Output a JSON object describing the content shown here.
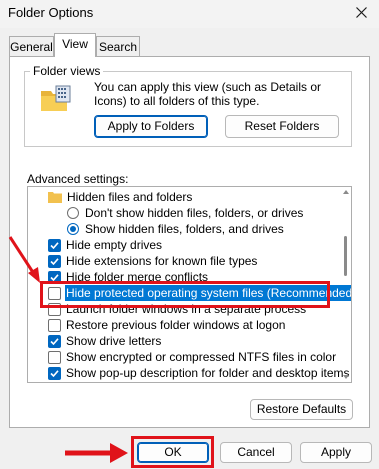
{
  "window": {
    "title": "Folder Options"
  },
  "tabs": [
    {
      "label": "General",
      "active": false
    },
    {
      "label": "View",
      "active": true
    },
    {
      "label": "Search",
      "active": false
    }
  ],
  "folder_views": {
    "heading": "Folder views",
    "description": "You can apply this view (such as Details or Icons) to all folders of this type.",
    "apply_button": "Apply to Folders",
    "reset_button": "Reset Folders"
  },
  "advanced": {
    "heading": "Advanced settings:",
    "items": [
      {
        "label": "Hidden files and folders",
        "control": "folder"
      },
      {
        "label": "Don't show hidden files, folders, or drives",
        "control": "radio",
        "checked": false
      },
      {
        "label": "Show hidden files, folders, and drives",
        "control": "radio",
        "checked": true
      },
      {
        "label": "Hide empty drives",
        "control": "checkbox",
        "checked": true
      },
      {
        "label": "Hide extensions for known file types",
        "control": "checkbox",
        "checked": true
      },
      {
        "label": "Hide folder merge conflicts",
        "control": "checkbox",
        "checked": true
      },
      {
        "label": "Hide protected operating system files (Recommended)",
        "control": "checkbox",
        "checked": false,
        "highlighted": true
      },
      {
        "label": "Launch folder windows in a separate process",
        "control": "checkbox",
        "checked": false
      },
      {
        "label": "Restore previous folder windows at logon",
        "control": "checkbox",
        "checked": false
      },
      {
        "label": "Show drive letters",
        "control": "checkbox",
        "checked": true
      },
      {
        "label": "Show encrypted or compressed NTFS files in color",
        "control": "checkbox",
        "checked": false
      },
      {
        "label": "Show pop-up description for folder and desktop items",
        "control": "checkbox",
        "checked": true
      }
    ],
    "restore_button": "Restore Defaults"
  },
  "footer": {
    "ok": "OK",
    "cancel": "Cancel",
    "apply": "Apply"
  },
  "colors": {
    "accent": "#0067c0",
    "selection": "#0078d4",
    "annotation": "#e0131a"
  }
}
